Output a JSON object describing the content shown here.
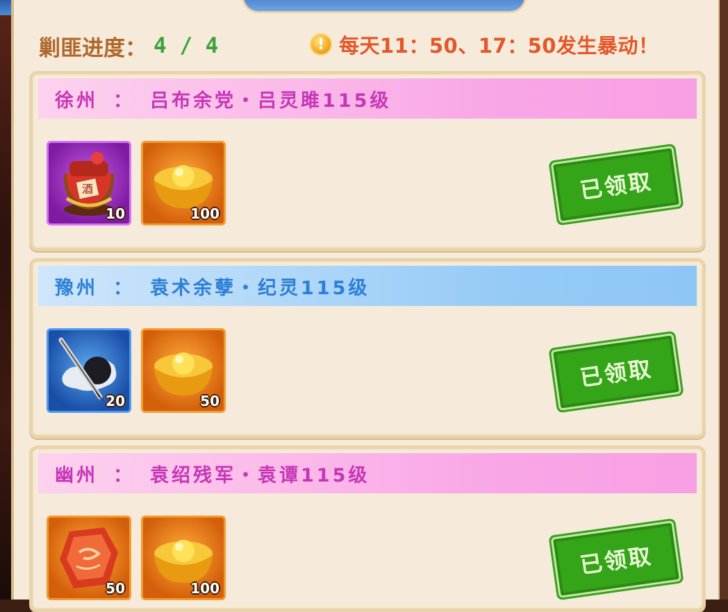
{
  "window": {
    "title": ""
  },
  "header": {
    "progress_label": "剿匪进度：",
    "progress_value": "4 / 4",
    "riot_notice": "每天11：50、17：50发生暴动！",
    "alert_icon": "!"
  },
  "rewards": [
    {
      "region": "徐州",
      "colon": "：",
      "boss": "吕布余党・吕灵雎115级",
      "header_theme": "pink",
      "items": [
        {
          "icon": "wine-jar-icon",
          "count": "10",
          "rarity": "purple"
        },
        {
          "icon": "gold-ingot-icon",
          "count": "100",
          "rarity": "orange"
        }
      ],
      "status": "已领取"
    },
    {
      "region": "豫州",
      "colon": "：",
      "boss": "袁术余孽・纪灵115级",
      "header_theme": "blue",
      "items": [
        {
          "icon": "ink-brush-icon",
          "count": "20",
          "rarity": "blue"
        },
        {
          "icon": "gold-ingot-icon",
          "count": "50",
          "rarity": "orange"
        }
      ],
      "status": "已领取"
    },
    {
      "region": "幽州",
      "colon": "：",
      "boss": "袁绍残军・袁谭115级",
      "header_theme": "pink",
      "items": [
        {
          "icon": "red-gem-icon",
          "count": "50",
          "rarity": "orange"
        },
        {
          "icon": "gold-ingot-icon",
          "count": "100",
          "rarity": "orange"
        }
      ],
      "status": "已领取"
    }
  ],
  "colors": {
    "progress_label": "#b0662c",
    "progress_value": "#3ea23a",
    "riot_text": "#e3572a",
    "stamp_green": "#34a418",
    "header_pink_text": "#c636b6",
    "header_blue_text": "#2c7fd6"
  }
}
